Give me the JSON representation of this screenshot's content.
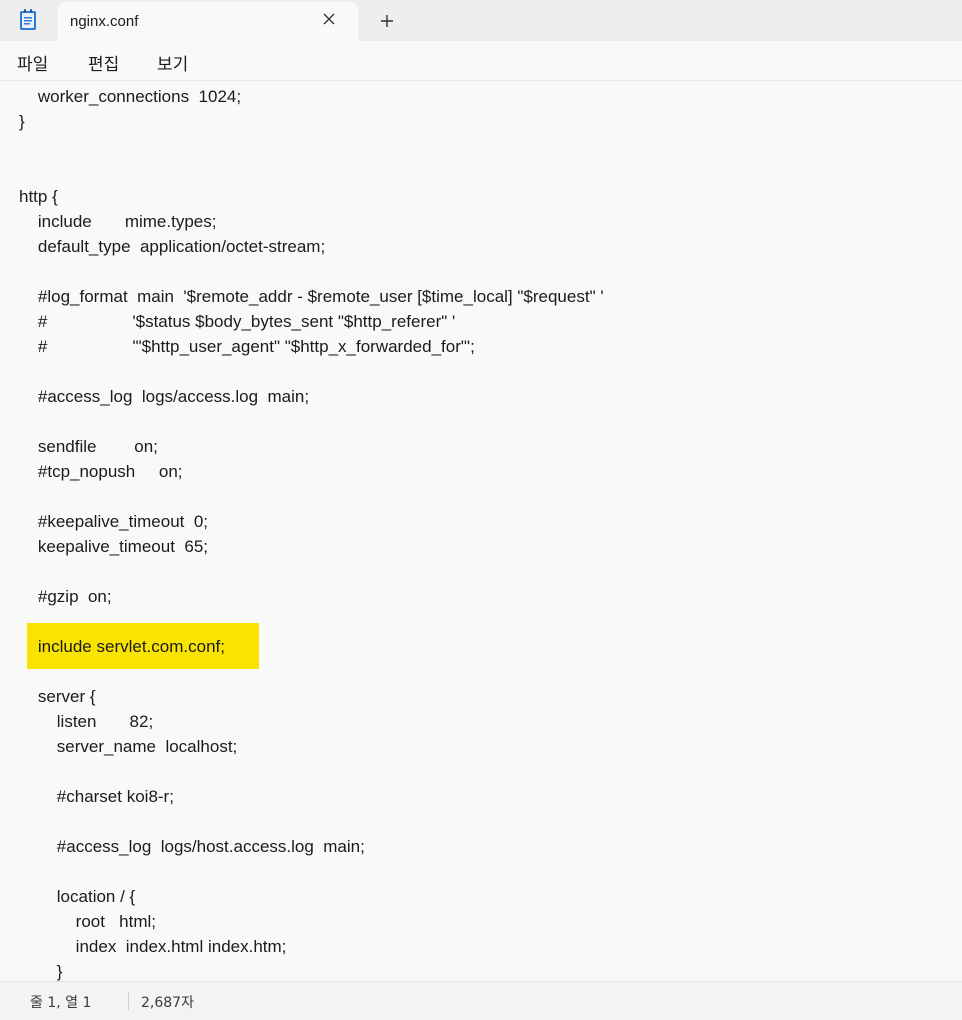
{
  "window": {
    "tab_title": "nginx.conf",
    "app_icon": "notepad-icon",
    "close_icon": "close-icon",
    "new_tab_icon": "plus-icon"
  },
  "menu": {
    "file": "파일",
    "edit": "편집",
    "view": "보기"
  },
  "editor": {
    "highlight_color": "#f8e400",
    "highlighted_line_index": 22,
    "lines": [
      "    worker_connections  1024;",
      "}",
      "",
      "",
      "http {",
      "    include       mime.types;",
      "    default_type  application/octet-stream;",
      "",
      "    #log_format  main  '$remote_addr - $remote_user [$time_local] \"$request\" '",
      "    #                  '$status $body_bytes_sent \"$http_referer\" '",
      "    #                  '\"$http_user_agent\" \"$http_x_forwarded_for\"';",
      "",
      "    #access_log  logs/access.log  main;",
      "",
      "    sendfile        on;",
      "    #tcp_nopush     on;",
      "",
      "    #keepalive_timeout  0;",
      "    keepalive_timeout  65;",
      "",
      "    #gzip  on;",
      "",
      "    include servlet.com.conf;",
      "",
      "    server {",
      "        listen       82;",
      "        server_name  localhost;",
      "",
      "        #charset koi8-r;",
      "",
      "        #access_log  logs/host.access.log  main;",
      "",
      "        location / {",
      "            root   html;",
      "            index  index.html index.htm;",
      "        }"
    ]
  },
  "status": {
    "position": "줄 1, 열 1",
    "char_count": "2,687자"
  }
}
